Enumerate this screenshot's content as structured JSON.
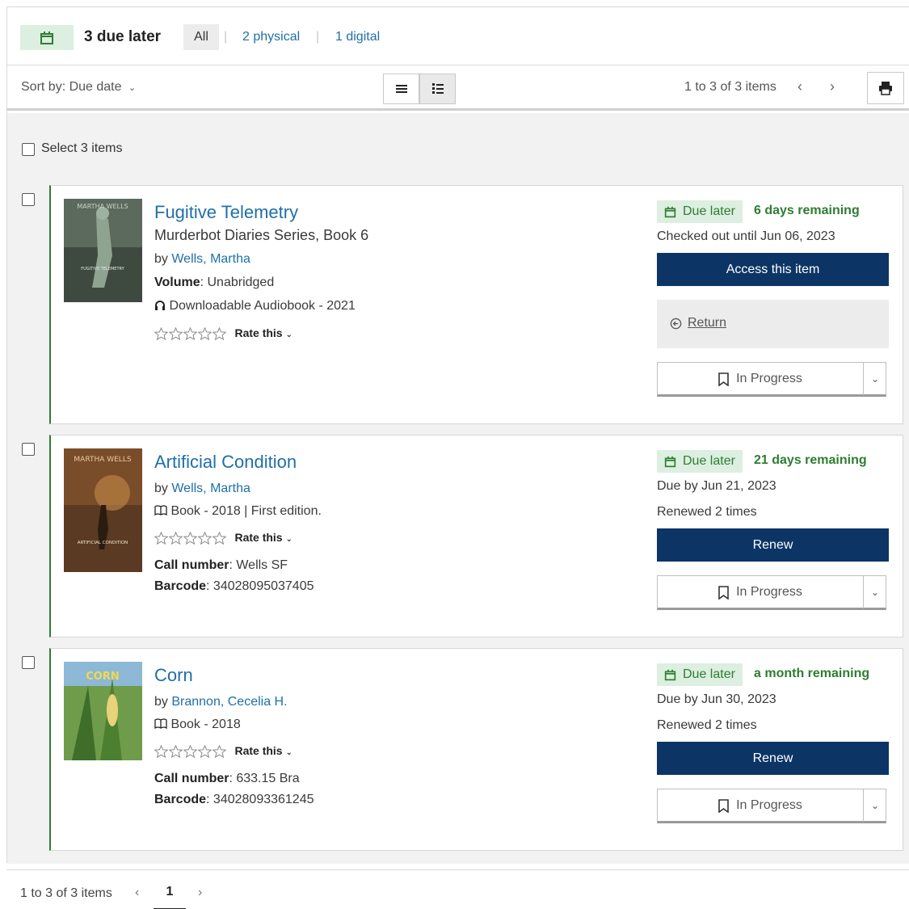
{
  "header": {
    "due_icon": "calendar-icon",
    "due_count": "3 due later",
    "filters": {
      "all": "All",
      "physical": "2 physical",
      "digital": "1 digital"
    }
  },
  "toolbar": {
    "sort_label": "Sort by: Due date",
    "pager_text": "1 to 3 of 3 items",
    "list_view_icon": "list-icon",
    "detail_view_icon": "detail-list-icon",
    "print_icon": "print-icon"
  },
  "select_all_label": "Select 3 items",
  "items": [
    {
      "title": "Fugitive Telemetry",
      "series": "Murderbot Diaries Series, Book 6",
      "by": "by",
      "author": "Wells, Martha",
      "volume_label": "Volume",
      "volume_value": ": Unabridged",
      "format": "Downloadable Audiobook - 2021",
      "rate_label": "Rate this",
      "due_label": "Due later",
      "remaining": "6 days remaining",
      "status_line": "Checked out until Jun 06, 2023",
      "primary_action": "Access this item",
      "return_label": "Return",
      "shelf_label": "In Progress"
    },
    {
      "title": "Artificial Condition",
      "by": "by",
      "author": "Wells, Martha",
      "format": "Book - 2018 | First edition.",
      "rate_label": "Rate this",
      "call_label": "Call number",
      "call_value": ": Wells SF",
      "barcode_label": "Barcode",
      "barcode_value": ": 34028095037405",
      "due_label": "Due later",
      "remaining": "21 days remaining",
      "status_line": "Due by Jun 21, 2023",
      "renewed": "Renewed 2 times",
      "primary_action": "Renew",
      "shelf_label": "In Progress"
    },
    {
      "title": "Corn",
      "by": "by",
      "author": "Brannon, Cecelia H.",
      "format": "Book - 2018",
      "rate_label": "Rate this",
      "call_label": "Call number",
      "call_value": ": 633.15 Bra",
      "barcode_label": "Barcode",
      "barcode_value": ": 34028093361245",
      "due_label": "Due later",
      "remaining": "a month remaining",
      "status_line": "Due by Jun 30, 2023",
      "renewed": "Renewed 2 times",
      "primary_action": "Renew",
      "shelf_label": "In Progress"
    }
  ],
  "covers": [
    {
      "top_text": "MARTHA WELLS",
      "bottom_text": "FUGITIVE TELEMETRY"
    },
    {
      "top_text": "MARTHA WELLS",
      "bottom_text": "ARTIFICIAL CONDITION"
    },
    {
      "top_text": "CORN"
    }
  ],
  "footer": {
    "pager_text": "1 to 3 of 3 items",
    "page": "1"
  },
  "colors": {
    "accent": "#1f6fa8",
    "primary_button": "#0c3566",
    "due_green": "#2e7d32",
    "due_bg": "#dcefe0"
  }
}
